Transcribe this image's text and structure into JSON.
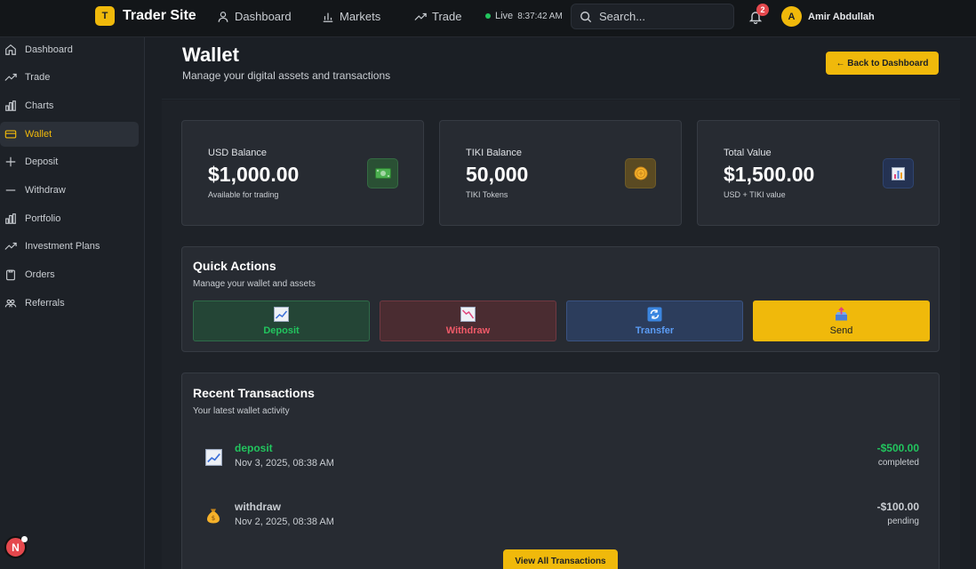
{
  "app": {
    "logo_letter": "T",
    "name": "Trader Site"
  },
  "topnav": [
    {
      "label": "Dashboard",
      "icon": "user-icon"
    },
    {
      "label": "Markets",
      "icon": "bar-chart-icon"
    },
    {
      "label": "Trade",
      "icon": "trend-up-icon"
    }
  ],
  "status": {
    "live_label": "Live",
    "time": "8:37:42 AM",
    "live_color": "#22c55e"
  },
  "search": {
    "placeholder": "Search..."
  },
  "notifications": {
    "count": "2"
  },
  "user": {
    "initial": "A",
    "name": "Amir Abdullah"
  },
  "sidebar": {
    "items": [
      {
        "label": "Dashboard",
        "icon": "home-icon"
      },
      {
        "label": "Trade",
        "icon": "trend-up-icon"
      },
      {
        "label": "Charts",
        "icon": "bar-chart-icon"
      },
      {
        "label": "Wallet",
        "icon": "wallet-icon",
        "active": true
      },
      {
        "label": "Deposit",
        "icon": "plus-icon"
      },
      {
        "label": "Withdraw",
        "icon": "minus-icon"
      },
      {
        "label": "Portfolio",
        "icon": "bar-chart-icon"
      },
      {
        "label": "Investment Plans",
        "icon": "trend-up-icon"
      },
      {
        "label": "Orders",
        "icon": "clipboard-icon"
      },
      {
        "label": "Referrals",
        "icon": "users-icon"
      }
    ],
    "dev_badge": "N"
  },
  "page": {
    "title": "Wallet",
    "subtitle": "Manage your digital assets and transactions",
    "back_button": "← Back to Dashboard"
  },
  "balances": [
    {
      "label": "USD Balance",
      "value": "$1,000.00",
      "sub": "Available for trading",
      "icon": "money-icon"
    },
    {
      "label": "TIKI Balance",
      "value": "50,000",
      "sub": "TIKI Tokens",
      "icon": "coin-icon"
    },
    {
      "label": "Total Value",
      "value": "$1,500.00",
      "sub": "USD + TIKI value",
      "icon": "chart-icon"
    }
  ],
  "quick_actions": {
    "title": "Quick Actions",
    "subtitle": "Manage your wallet and assets",
    "buttons": [
      {
        "label": "Deposit",
        "icon": "chart-up-icon"
      },
      {
        "label": "Withdraw",
        "icon": "chart-down-icon"
      },
      {
        "label": "Transfer",
        "icon": "refresh-icon"
      },
      {
        "label": "Send",
        "icon": "outbox-icon"
      }
    ]
  },
  "transactions": {
    "title": "Recent Transactions",
    "subtitle": "Your latest wallet activity",
    "items": [
      {
        "type": "deposit",
        "date": "Nov 3, 2025, 08:38 AM",
        "amount": "-$500.00",
        "status": "completed",
        "icon": "chart-up-icon"
      },
      {
        "type": "withdraw",
        "date": "Nov 2, 2025, 08:38 AM",
        "amount": "-$100.00",
        "status": "pending",
        "icon": "money-bag-icon"
      }
    ],
    "view_all": "View All Transactions"
  },
  "colors": {
    "accent": "#f0b90b",
    "success": "#22c55e",
    "danger": "#f05a68",
    "info": "#5b9cf5"
  }
}
